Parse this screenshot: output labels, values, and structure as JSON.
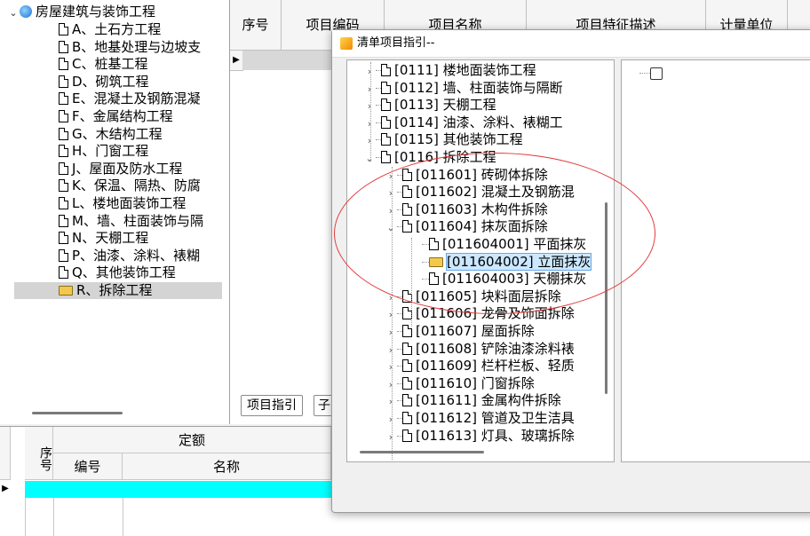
{
  "left_tree": {
    "root": "房屋建筑与装饰工程",
    "items": [
      "A、土石方工程",
      "B、地基处理与边坡支",
      "C、桩基工程",
      "D、砌筑工程",
      "E、混凝土及钢筋混凝",
      "F、金属结构工程",
      "G、木结构工程",
      "H、门窗工程",
      "J、屋面及防水工程",
      "K、保温、隔热、防腐",
      "L、楼地面装饰工程",
      "M、墙、柱面装饰与隔",
      "N、天棚工程",
      "P、油漆、涂料、裱糊",
      "Q、其他装饰工程",
      "R、拆除工程"
    ],
    "selected_index": 15
  },
  "top_grid": {
    "headers": [
      "序号",
      "项目编码",
      "项目名称",
      "项目特征描述",
      "计量单位"
    ]
  },
  "tabs": {
    "guide": "项目指引",
    "sub": "子"
  },
  "bottom_grid": {
    "seq_header": "序号",
    "quota_header": "定额",
    "code_header": "编号",
    "name_header": "名称"
  },
  "dialog": {
    "title": "清单项目指引--",
    "tree": [
      {
        "level": 0,
        "chev": "›",
        "icon": "doc",
        "label": "[0111] 楼地面装饰工程"
      },
      {
        "level": 0,
        "chev": "›",
        "icon": "doc",
        "label": "[0112] 墙、柱面装饰与隔断"
      },
      {
        "level": 0,
        "chev": "›",
        "icon": "doc",
        "label": "[0113] 天棚工程"
      },
      {
        "level": 0,
        "chev": "›",
        "icon": "doc",
        "label": "[0114] 油漆、涂料、裱糊工"
      },
      {
        "level": 0,
        "chev": "›",
        "icon": "doc",
        "label": "[0115] 其他装饰工程"
      },
      {
        "level": 0,
        "chev": "⌄",
        "icon": "doc",
        "label": "[0116] 拆除工程"
      },
      {
        "level": 1,
        "chev": "›",
        "icon": "doc",
        "label": "[011601] 砖砌体拆除"
      },
      {
        "level": 1,
        "chev": "›",
        "icon": "doc",
        "label": "[011602] 混凝土及钢筋混"
      },
      {
        "level": 1,
        "chev": "›",
        "icon": "doc",
        "label": "[011603] 木构件拆除"
      },
      {
        "level": 1,
        "chev": "⌄",
        "icon": "doc",
        "label": "[011604] 抹灰面拆除"
      },
      {
        "level": 2,
        "chev": "",
        "icon": "doc",
        "label": "[011604001] 平面抹灰"
      },
      {
        "level": 2,
        "chev": "",
        "icon": "folder",
        "label": "[011604002] 立面抹灰",
        "selected": true
      },
      {
        "level": 2,
        "chev": "",
        "icon": "doc",
        "label": "[011604003] 天棚抹灰"
      },
      {
        "level": 1,
        "chev": "›",
        "icon": "doc",
        "label": "[011605] 块料面层拆除"
      },
      {
        "level": 1,
        "chev": "›",
        "icon": "doc",
        "label": "[011606] 龙骨及饰面拆除"
      },
      {
        "level": 1,
        "chev": "›",
        "icon": "doc",
        "label": "[011607] 屋面拆除"
      },
      {
        "level": 1,
        "chev": "›",
        "icon": "doc",
        "label": "[011608] 铲除油漆涂料裱"
      },
      {
        "level": 1,
        "chev": "›",
        "icon": "doc",
        "label": "[011609] 栏杆栏板、轻质"
      },
      {
        "level": 1,
        "chev": "›",
        "icon": "doc",
        "label": "[011610] 门窗拆除"
      },
      {
        "level": 1,
        "chev": "›",
        "icon": "doc",
        "label": "[011611] 金属构件拆除"
      },
      {
        "level": 1,
        "chev": "›",
        "icon": "doc",
        "label": "[011612] 管道及卫生洁具"
      },
      {
        "level": 1,
        "chev": "›",
        "icon": "doc",
        "label": "[011613] 灯具、玻璃拆除"
      }
    ]
  },
  "colors": {
    "selection_highlight": "#cce8ff",
    "bottom_row_highlight": "#00ffff",
    "annotation_ellipse": "#e23a3a"
  }
}
